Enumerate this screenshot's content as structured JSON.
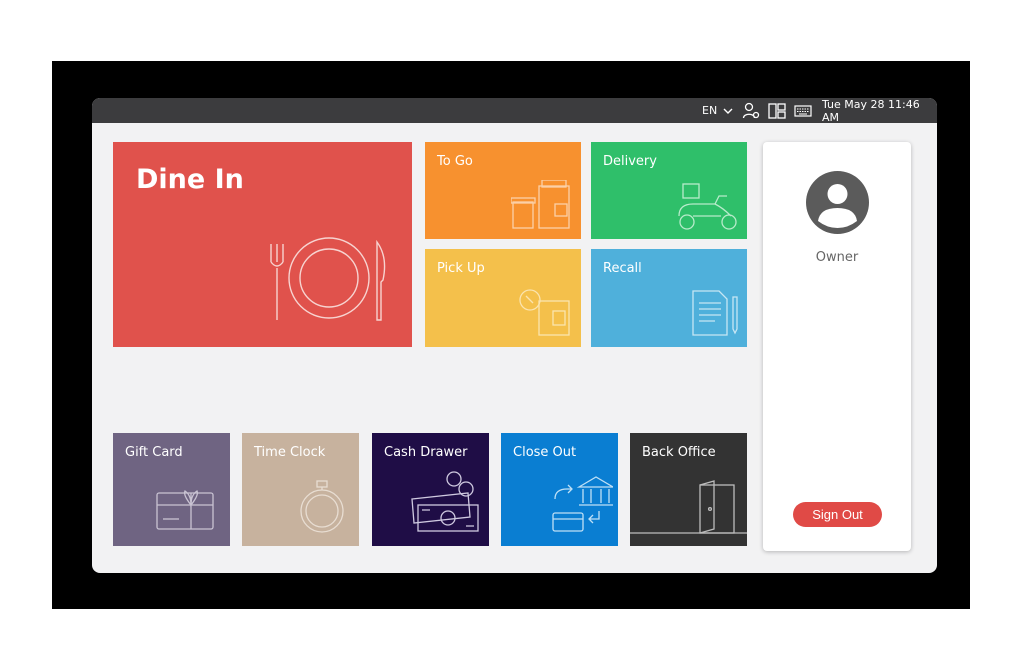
{
  "topbar": {
    "language": "EN",
    "datetime": "Tue May 28 11:46 AM"
  },
  "tiles": {
    "dine_in": {
      "label": "Dine In",
      "color": "#e0524c"
    },
    "to_go": {
      "label": "To Go",
      "color": "#f7912f"
    },
    "delivery": {
      "label": "Delivery",
      "color": "#2fbf6a"
    },
    "pick_up": {
      "label": "Pick Up",
      "color": "#f4c04b"
    },
    "recall": {
      "label": "Recall",
      "color": "#4fb0db"
    },
    "gift_card": {
      "label": "Gift Card",
      "color": "#6f6482"
    },
    "time_clock": {
      "label": "Time Clock",
      "color": "#c7b29e"
    },
    "cash_drawer": {
      "label": "Cash Drawer",
      "color": "#1f0d46"
    },
    "close_out": {
      "label": "Close Out",
      "color": "#0a7ed2"
    },
    "back_office": {
      "label": "Back Office",
      "color": "#333333"
    }
  },
  "user": {
    "role": "Owner",
    "sign_out_label": "Sign Out"
  }
}
